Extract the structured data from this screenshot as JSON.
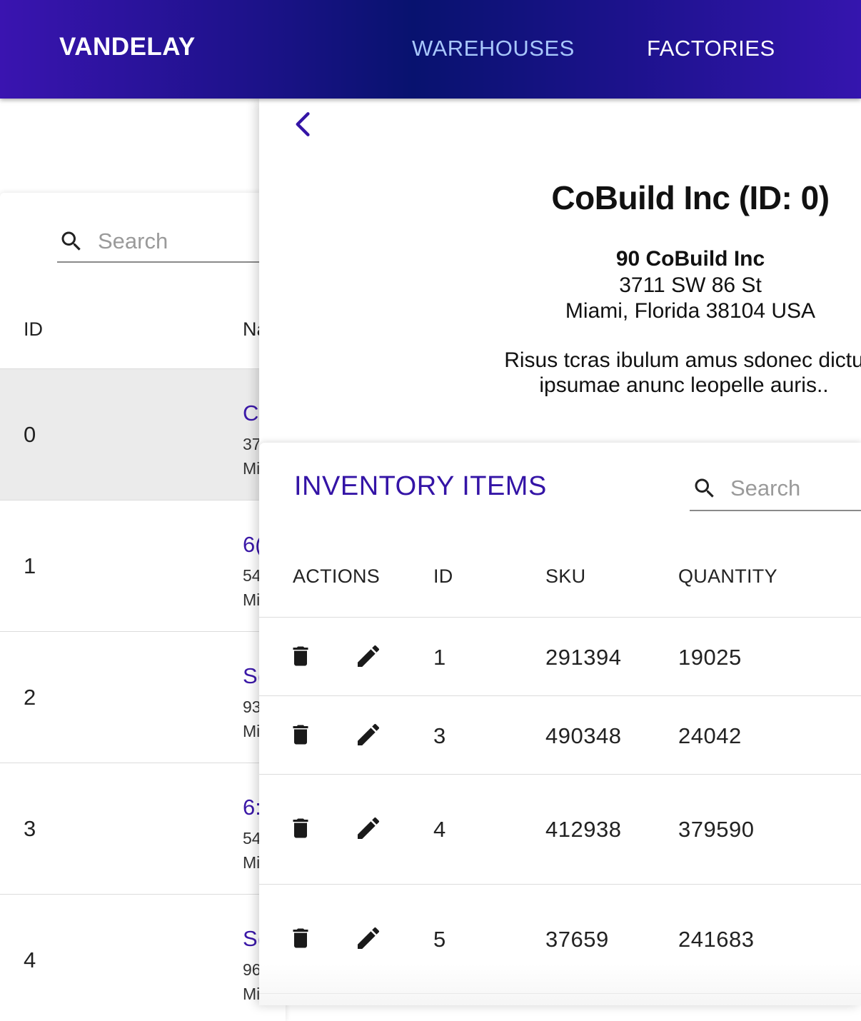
{
  "appbar": {
    "brand": "VANDELAY",
    "nav": [
      {
        "label": "WAREHOUSES",
        "active": true
      },
      {
        "label": "FACTORIES",
        "active": false
      }
    ]
  },
  "factory_list": {
    "search_placeholder": "Search",
    "headers": {
      "id": "ID",
      "name": "Na"
    },
    "rows": [
      {
        "id": "0",
        "name": "C",
        "addr1": "37",
        "addr2": "Mi",
        "selected": true
      },
      {
        "id": "1",
        "name": "6(",
        "addr1": "54",
        "addr2": "Mi",
        "selected": false
      },
      {
        "id": "2",
        "name": "S(",
        "addr1": "93",
        "addr2": "Mi",
        "selected": false
      },
      {
        "id": "3",
        "name": "6:",
        "addr1": "54",
        "addr2": "Mi",
        "selected": false
      },
      {
        "id": "4",
        "name": "S(",
        "addr1": "96",
        "addr2": "Mi",
        "selected": false
      }
    ]
  },
  "detail": {
    "title": "CoBuild Inc (ID: 0)",
    "address": {
      "name": "90 CoBuild Inc",
      "street": "3711 SW 86 St",
      "city": "Miami, Florida 38104 USA"
    },
    "description": [
      "Risus tcras ibulum amus sdonec dictu",
      "ipsumae anunc leopelle auris.."
    ]
  },
  "inventory": {
    "title": "INVENTORY ITEMS",
    "search_placeholder": "Search",
    "headers": {
      "actions": "ACTIONS",
      "id": "ID",
      "sku": "SKU",
      "quantity": "QUANTITY"
    },
    "rows": [
      {
        "id": "1",
        "sku": "291394",
        "quantity": "19025"
      },
      {
        "id": "3",
        "sku": "490348",
        "quantity": "24042"
      },
      {
        "id": "4",
        "sku": "412938",
        "quantity": "379590"
      },
      {
        "id": "5",
        "sku": "37659",
        "quantity": "241683"
      }
    ]
  },
  "colors": {
    "brand_purple": "#3414a6",
    "nav_active": "#a8c7fb",
    "selected_row": "#ebebeb"
  },
  "icons": {
    "search": "search-icon",
    "back": "chevron-left-icon",
    "delete": "trash-icon",
    "edit": "pencil-icon"
  }
}
